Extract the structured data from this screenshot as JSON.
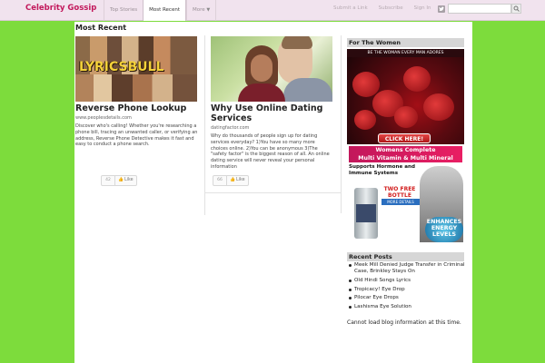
{
  "header": {
    "brand": "Celebrity Gossip",
    "nav": [
      {
        "label": "Top Stories"
      },
      {
        "label": "Most Recent"
      },
      {
        "label": "More"
      }
    ],
    "links": [
      "Submit a Link",
      "Subscribe",
      "Sign In"
    ],
    "search": {
      "placeholder": "",
      "value": ""
    }
  },
  "main": {
    "section_title": "Most Recent",
    "cards": [
      {
        "image_text": "LYRICSBULL",
        "title": "Reverse Phone Lookup",
        "source": "www.peoplesdetails.com",
        "description": "Discover who's calling! Whether you're researching a phone bill, tracing an unwanted caller, or verifying an address, Reverse Phone Detective makes it fast and easy to conduct a phone search.",
        "count": "42",
        "like_label": "Like"
      },
      {
        "title": "Why Use Online Dating Services",
        "source": "datingfactor.com",
        "description": "Why do thousands of people sign up for dating services everyday? 1)You have so many more choices online. 2)You can be anonymous 3)The \"safety factor\" is the biggest reason of all. An online dating service will never reveal your personal information",
        "count": "66",
        "like_label": "Like"
      }
    ]
  },
  "sidebar": {
    "for_women": {
      "heading": "For The Women",
      "ad": {
        "tagline": "BE THE WOMAN EVERY MAN ADORES",
        "cta": "CLICK HERE!",
        "line1": "Womens Complete",
        "line2": "Multi Vitamin & Multi Mineral",
        "support": "Supports Hormone and Immune Systems",
        "offer": "TWO FREE BOTTLE OFFER",
        "more": "MORE DETAILS",
        "energy": "ENHANCES ENERGY LEVELS"
      }
    },
    "recent_posts": {
      "heading": "Recent Posts",
      "items": [
        "Meek Mill Denied Judge Transfer in Criminal Case, Brinkley Stays On",
        "Old Hindi Songs Lyrics",
        "Tropicacy! Eye Drop",
        "Pilocar Eye Drops",
        "Lashisma Eye Solution"
      ]
    },
    "blog_error": "Cannot load blog information at this time."
  },
  "colors": {
    "background": "#7ddc3c",
    "brand": "#c2185b",
    "topbar": "#f1e3ee"
  }
}
